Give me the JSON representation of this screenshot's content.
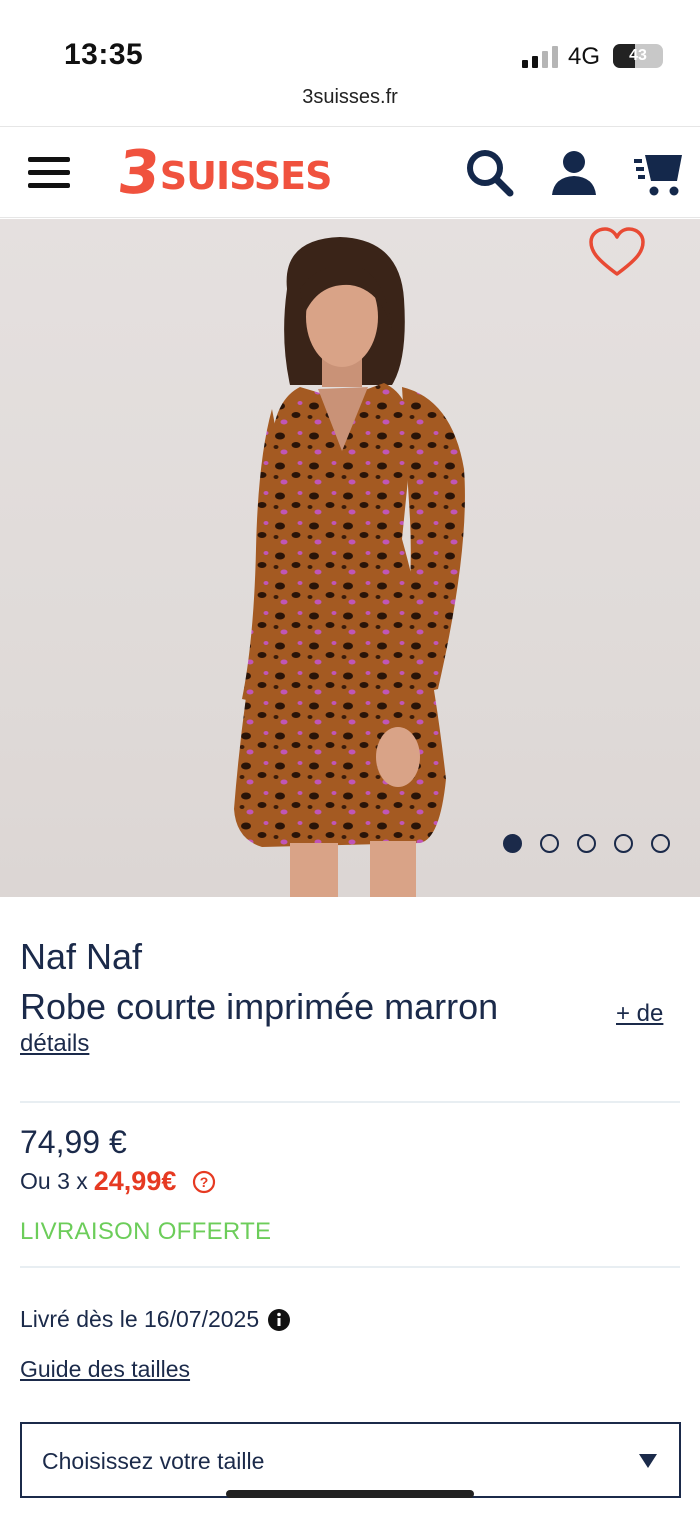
{
  "status_bar": {
    "time": "13:35",
    "network": "4G",
    "battery": "43",
    "battery_level": 0.43,
    "url": "3suisses.fr"
  },
  "header": {
    "logo_number": "3",
    "logo_word": "SUISSES",
    "brand_color": "#f0523e",
    "icons": [
      "menu-icon",
      "search-icon",
      "account-icon",
      "cart-icon"
    ]
  },
  "gallery": {
    "image_count": 5,
    "active_index": 0,
    "icons": [
      "heart-icon"
    ]
  },
  "product": {
    "brand": "Naf Naf",
    "title": "Robe courte imprimée marron",
    "details_link_part1": "+ de",
    "details_link_part2": "détails",
    "price": "74,99 €",
    "installment_prefix": "Ou 3 x",
    "installment_amount": "24,99€",
    "delivery_offer": "LIVRAISON OFFERTE",
    "delivery_date_text": "Livré dès le 16/07/2025",
    "size_guide": "Guide des tailles",
    "size_select_placeholder": "Choisissez votre taille",
    "accent_color": "#e63a22",
    "offer_color": "#6ccd5a",
    "text_color": "#1b2a4a"
  }
}
